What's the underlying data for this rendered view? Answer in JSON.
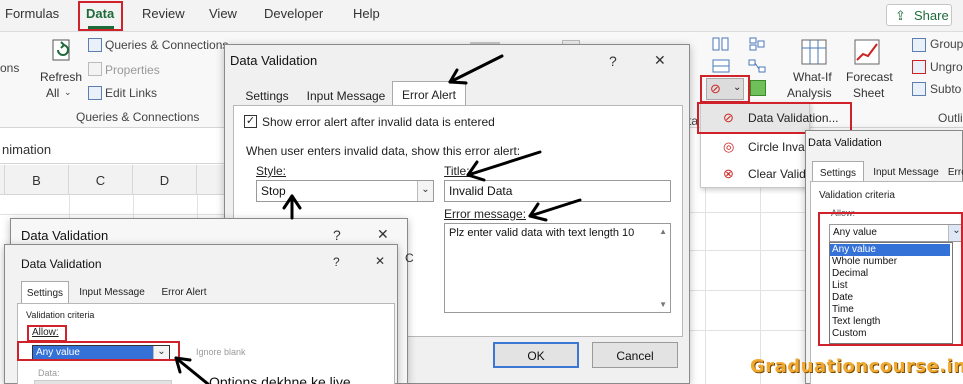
{
  "ribbon": {
    "tabs": [
      "Formulas",
      "Data",
      "Review",
      "View",
      "Developer",
      "Help"
    ],
    "active_tab": "Data",
    "share_label": "Share",
    "groups": {
      "connections_label": "Queries & Connections",
      "refresh_label": "Refresh",
      "refresh_all_label": "All",
      "queries_connections": "Queries & Connections",
      "properties": "Properties",
      "edit_links": "Edit Links",
      "left_fragment": "ons",
      "whatif_label": "What-If",
      "whatif_label2": "Analysis",
      "forecast_label": "Forecast",
      "forecast_label2": "Sheet",
      "group_label": "Group",
      "ungroup_label": "Ungro",
      "subtotal_label": "Subto",
      "outline_label": "Outli",
      "ta_fragment": "ta"
    }
  },
  "sheet": {
    "name_box": "nimation",
    "columns": [
      "B",
      "C",
      "D"
    ]
  },
  "data_menu": {
    "items": [
      "Data Validation...",
      "Circle Inva",
      "Clear Valid"
    ]
  },
  "main_dialog": {
    "title": "Data Validation",
    "help": "?",
    "close": "✕",
    "tabs": [
      "Settings",
      "Input Message",
      "Error Alert"
    ],
    "active_tab": "Error Alert",
    "show_alert_label": "Show error alert after invalid data is entered",
    "show_alert_checked": true,
    "when_label": "When user enters invalid data, show this error alert:",
    "style_label": "Style:",
    "style_value": "Stop",
    "title_label": "Title:",
    "title_value": "Invalid Data",
    "message_label": "Error message:",
    "message_value": "Plz enter valid data with text length 10",
    "ok_label": "OK",
    "cancel_label": "Cancel"
  },
  "lower_dialog": {
    "outer_title": "Data Validation",
    "inner_title": "Data Validation",
    "help": "?",
    "close": "✕",
    "tabs": [
      "Settings",
      "Input Message",
      "Error Alert"
    ],
    "criteria_label": "Validation criteria",
    "allow_label": "Allow:",
    "allow_value": "Any value",
    "ignore_blank": "Ignore blank",
    "data_label": "Data:",
    "annotation": "Options dekhne ke liye"
  },
  "right_dialog": {
    "title": "Data Validation",
    "tabs": [
      "Settings",
      "Input Message",
      "Error"
    ],
    "criteria_label": "Validation criteria",
    "allow_label": "Allow:",
    "allow_value": "Any value",
    "options": [
      "Any value",
      "Whole number",
      "Decimal",
      "List",
      "Date",
      "Time",
      "Text length",
      "Custom"
    ],
    "selected_option": "Any value"
  },
  "watermark": "Graduationcourse.in",
  "colors": {
    "highlight_red": "#d0222b",
    "excel_green": "#1e6b3a",
    "selection_blue": "#3572d8",
    "watermark_orange": "#f0a830"
  }
}
